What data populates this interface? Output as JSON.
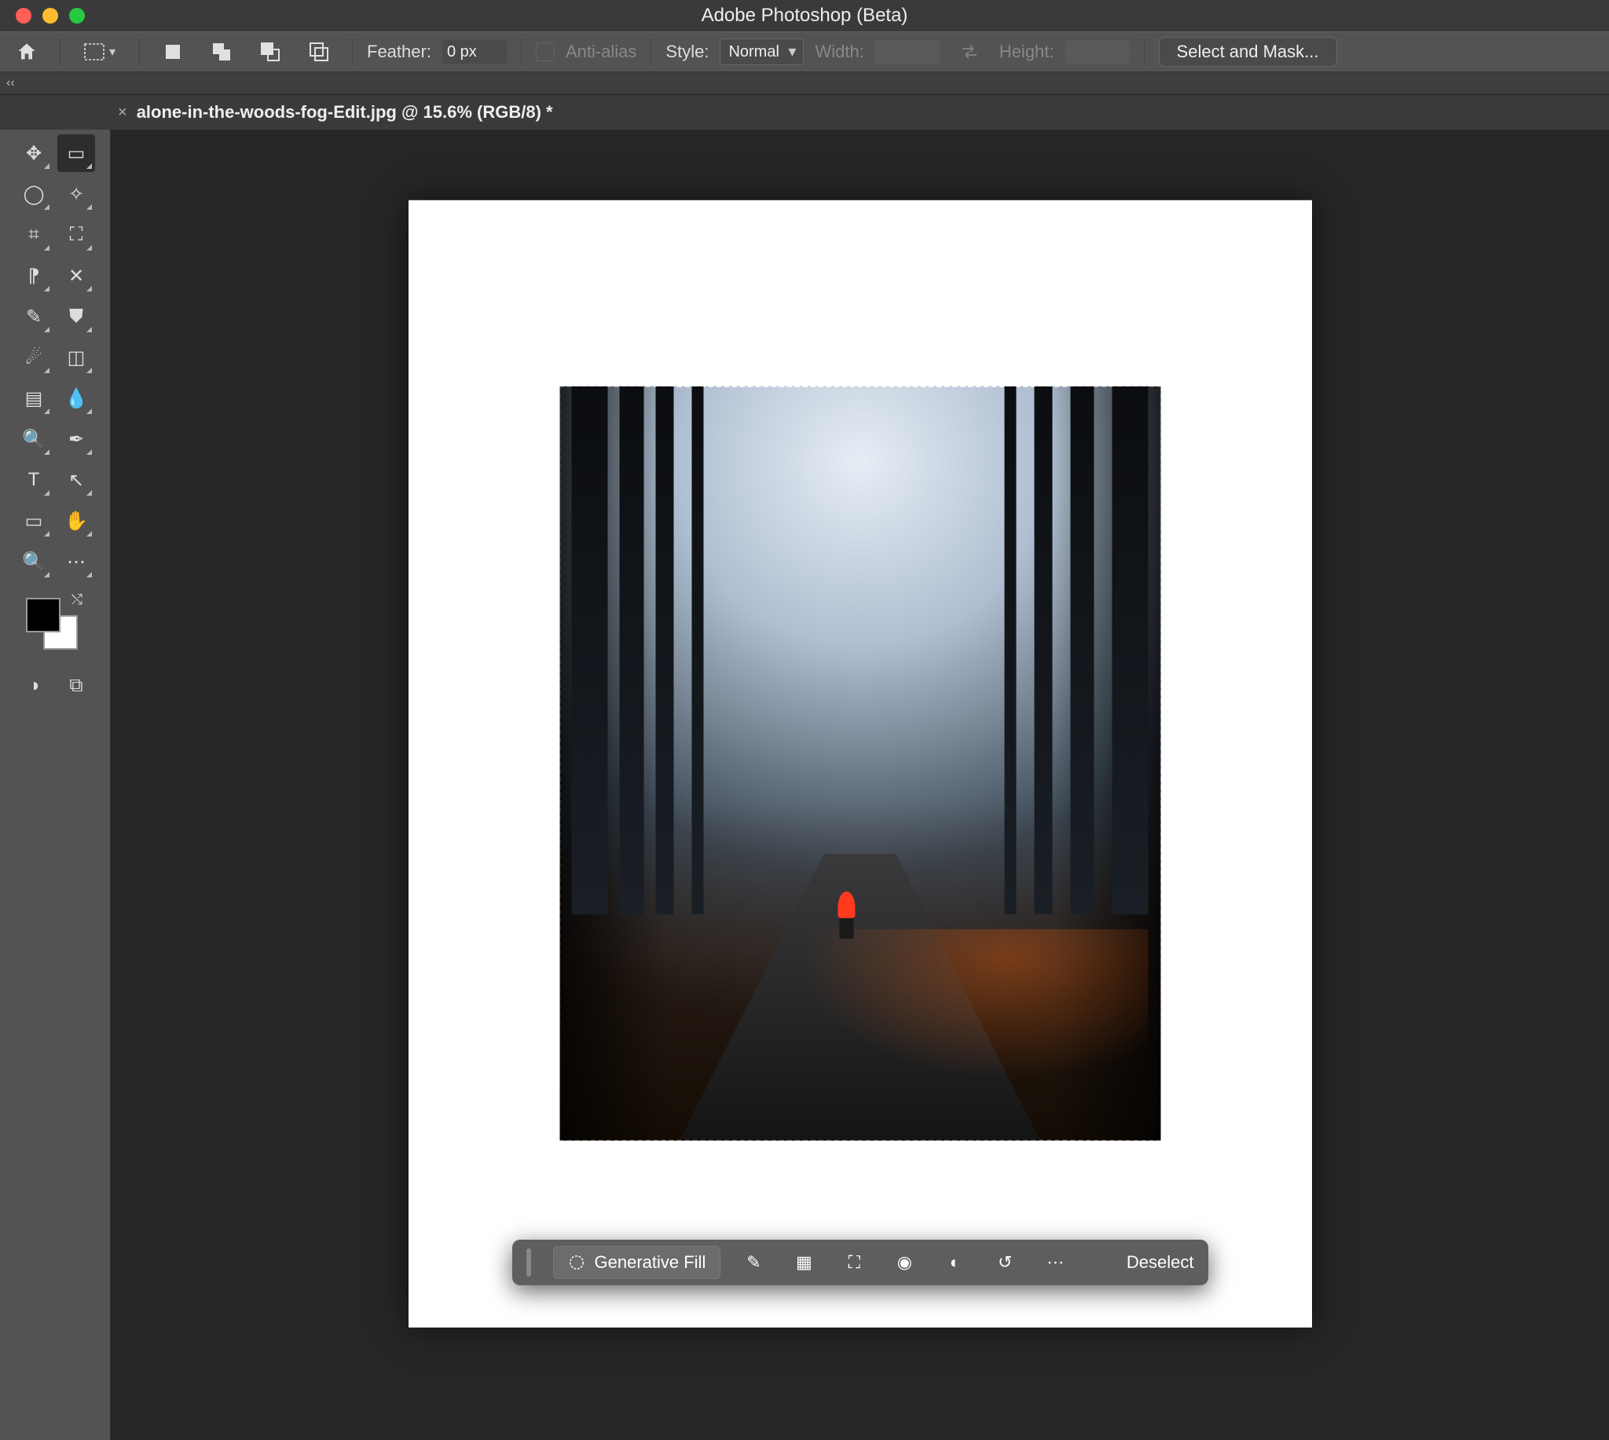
{
  "titlebar": {
    "app_title": "Adobe Photoshop (Beta)"
  },
  "optionsbar": {
    "feather_label": "Feather:",
    "feather_value": "0 px",
    "antialias_label": "Anti-alias",
    "style_label": "Style:",
    "style_value": "Normal",
    "width_label": "Width:",
    "height_label": "Height:",
    "select_mask_label": "Select and Mask..."
  },
  "collapse": {
    "label": "‹‹"
  },
  "tab": {
    "title": "alone-in-the-woods-fog-Edit.jpg @ 15.6% (RGB/8) *",
    "close": "×"
  },
  "tools": {
    "items": [
      [
        {
          "name": "move-tool",
          "glyph": "✥"
        },
        {
          "name": "marquee-tool",
          "glyph": "▭",
          "sel": true
        }
      ],
      [
        {
          "name": "lasso-tool",
          "glyph": "◯"
        },
        {
          "name": "magic-wand-tool",
          "glyph": "✧"
        }
      ],
      [
        {
          "name": "crop-tool",
          "glyph": "⌗"
        },
        {
          "name": "frame-tool",
          "glyph": "⛶"
        }
      ],
      [
        {
          "name": "eyedropper-tool",
          "glyph": "⁋"
        },
        {
          "name": "patch-tool",
          "glyph": "✕"
        }
      ],
      [
        {
          "name": "brush-tool",
          "glyph": "✎"
        },
        {
          "name": "stamp-tool",
          "glyph": "⛊"
        }
      ],
      [
        {
          "name": "history-brush-tool",
          "glyph": "☄"
        },
        {
          "name": "eraser-tool",
          "glyph": "◫"
        }
      ],
      [
        {
          "name": "gradient-tool",
          "glyph": "▤"
        },
        {
          "name": "blur-tool",
          "glyph": "💧"
        }
      ],
      [
        {
          "name": "dodge-tool",
          "glyph": "🔍"
        },
        {
          "name": "pen-tool",
          "glyph": "✒"
        }
      ],
      [
        {
          "name": "type-tool",
          "glyph": "T"
        },
        {
          "name": "path-select-tool",
          "glyph": "↖"
        }
      ],
      [
        {
          "name": "shape-tool",
          "glyph": "▭"
        },
        {
          "name": "hand-tool",
          "glyph": "✋"
        }
      ],
      [
        {
          "name": "zoom-tool",
          "glyph": "🔍"
        },
        {
          "name": "more-tools",
          "glyph": "⋯"
        }
      ]
    ],
    "bottom": [
      [
        {
          "name": "quick-mask",
          "glyph": "◑"
        },
        {
          "name": "screen-mode",
          "glyph": "⧉"
        }
      ]
    ]
  },
  "swatches": {
    "fg": "#000000",
    "bg": "#ffffff"
  },
  "ctb": {
    "gen_fill": "Generative Fill",
    "deselect": "Deselect",
    "icons": [
      {
        "name": "select-subject-icon",
        "glyph": "✎"
      },
      {
        "name": "remove-bg-icon",
        "glyph": "▦"
      },
      {
        "name": "transform-icon",
        "glyph": "⛶"
      },
      {
        "name": "fill-icon",
        "glyph": "◉"
      },
      {
        "name": "adjustment-icon",
        "glyph": "◐"
      },
      {
        "name": "flip-icon",
        "glyph": "↺"
      },
      {
        "name": "more-icon",
        "glyph": "⋯"
      }
    ]
  },
  "canvas": {
    "zoom": "15.6%",
    "mode": "RGB/8"
  }
}
